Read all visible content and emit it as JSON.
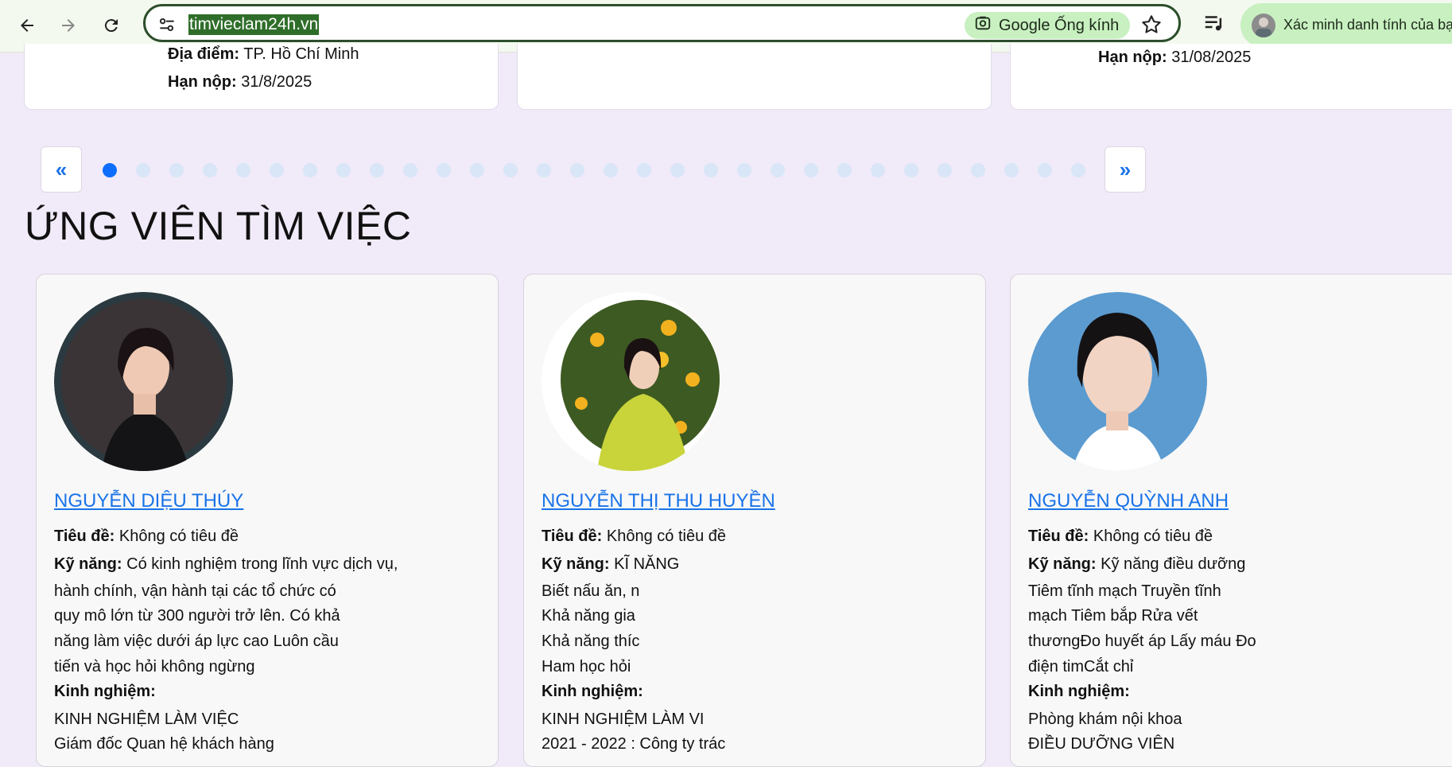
{
  "browser": {
    "url": "timvieclam24h.vn",
    "lens_label": "Google Ống kính",
    "profile_label": "Xác minh danh tính của bạ"
  },
  "jobs": [
    {
      "location_label": "Địa điểm:",
      "location": "TP. Hồ Chí Minh",
      "deadline_label": "Hạn nộp:",
      "deadline": "31/8/2025"
    },
    {},
    {
      "deadline_label": "Hạn nộp:",
      "deadline": "31/08/2025"
    }
  ],
  "pager": {
    "prev": "«",
    "next": "»",
    "dot_count": 30,
    "active_index": 0
  },
  "section_title": "ỨNG VIÊN TÌM VIỆC",
  "candidates": [
    {
      "name": "NGUYỄN DIỆU THÚY",
      "title_label": "Tiêu đề:",
      "title": "Không có tiêu đề",
      "skills_label": "Kỹ năng:",
      "skills": [
        "Có kinh nghiệm trong lĩnh vực dịch vụ,",
        "hành chính, vận hành tại các tổ chức có",
        "quy mô lớn từ 300 người trở lên. Có khả",
        "năng làm việc dưới áp lực cao Luôn cầu",
        "tiến và học hỏi không ngừng"
      ],
      "exp_label": "Kinh nghiệm:",
      "experience": [
        "KINH NGHIỆM LÀM VIỆC",
        "Giám đốc Quan hệ khách hàng"
      ]
    },
    {
      "name": "NGUYỄN THỊ THU HUYỀN",
      "title_label": "Tiêu đề:",
      "title": "Không có tiêu đề",
      "skills_label": "Kỹ năng:",
      "skills": [
        "KĨ NĂNG",
        "Biết nấu ăn, n",
        "Khả năng gia",
        "Khả năng thíc",
        "Ham học hỏi"
      ],
      "exp_label": "Kinh nghiệm:",
      "experience": [
        "KINH NGHIỆM LÀM VI",
        "2021 - 2022 : Công ty trác"
      ]
    },
    {
      "name": "NGUYỄN QUỲNH ANH",
      "title_label": "Tiêu đề:",
      "title": "Không có tiêu đề",
      "skills_label": "Kỹ năng:",
      "skills": [
        "Kỹ năng điều dưỡng",
        "Tiêm tĩnh mạch Truyền tĩnh",
        "mạch Tiêm bắp Rửa vết",
        "thươngĐo huyết áp Lấy máu Đo",
        "điện timCắt chỉ"
      ],
      "exp_label": "Kinh nghiệm:",
      "experience": [
        "Phòng khám nội khoa",
        "ĐIỀU DƯỠNG VIÊN"
      ]
    }
  ],
  "colors": {
    "accent": "#1a73e8",
    "active_dot": "#0d6efd",
    "page_bg": "#f1eaf8"
  }
}
